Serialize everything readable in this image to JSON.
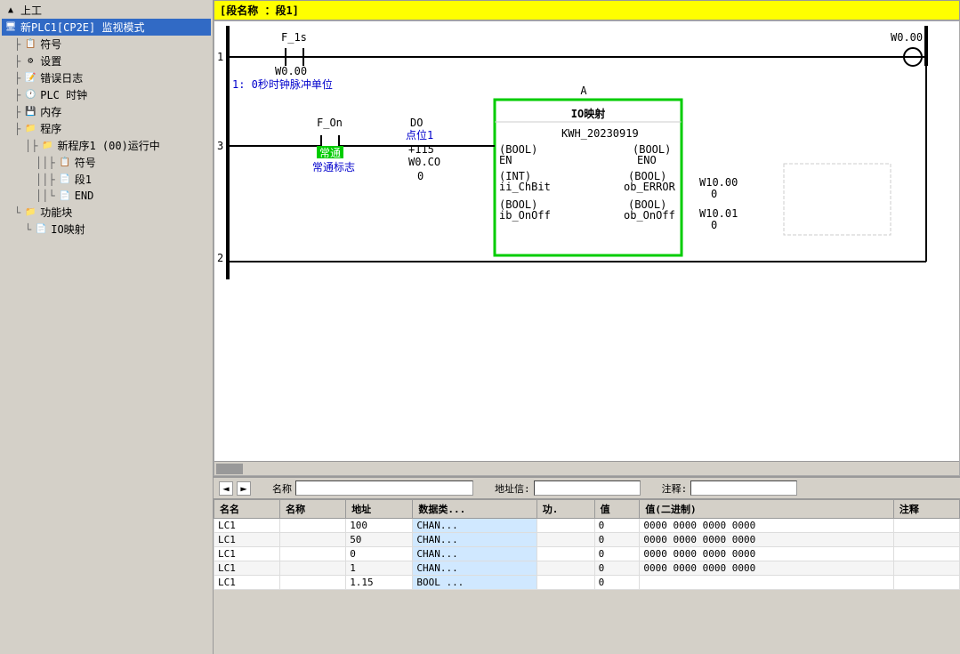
{
  "app": {
    "title": "新PLC1[CP2E] 监视模式"
  },
  "sidebar": {
    "items": [
      {
        "id": "plc-root",
        "label": "上工",
        "indent": 0,
        "icon": "📁"
      },
      {
        "id": "plc1",
        "label": "新PLC1[CP2E] 监视模式",
        "indent": 0,
        "icon": "🖥️"
      },
      {
        "id": "symbol",
        "label": "符号",
        "indent": 1,
        "icon": "📋"
      },
      {
        "id": "settings",
        "label": "设置",
        "indent": 1,
        "icon": "⚙️"
      },
      {
        "id": "error-log",
        "label": "错误日志",
        "indent": 1,
        "icon": "📝"
      },
      {
        "id": "plc-timer",
        "label": "PLC 时钟",
        "indent": 1,
        "icon": "🕐"
      },
      {
        "id": "memory",
        "label": "内存",
        "indent": 1,
        "icon": "💾"
      },
      {
        "id": "program",
        "label": "程序",
        "indent": 1,
        "icon": "📁"
      },
      {
        "id": "new-prog",
        "label": "新程序1 (00)运行中",
        "indent": 2,
        "icon": "📁"
      },
      {
        "id": "symbol2",
        "label": "符号",
        "indent": 3,
        "icon": "📋"
      },
      {
        "id": "rung1",
        "label": "段1",
        "indent": 3,
        "icon": "📄"
      },
      {
        "id": "end",
        "label": "END",
        "indent": 3,
        "icon": "📄"
      },
      {
        "id": "funcblock",
        "label": "功能块",
        "indent": 1,
        "icon": "📁"
      },
      {
        "id": "io-map",
        "label": "IO映射",
        "indent": 2,
        "icon": "📄"
      }
    ]
  },
  "diagram": {
    "title": "[段名称 ：段1]",
    "rung1": {
      "number": "1",
      "comment": "1: 0秒时钟脉冲单位",
      "contacts": [
        {
          "name": "F_1s",
          "address": "W0.00",
          "type": "normal"
        },
        {
          "name": "F_On",
          "address": "",
          "type": "normal"
        },
        {
          "name": "常通标志",
          "address": "",
          "type": "highlighted"
        }
      ],
      "coil": {
        "name": "W0.00",
        "type": "coil"
      },
      "funcblock": {
        "title": "IO映射",
        "label": "A",
        "ports_left": [
          {
            "type": "(BOOL)",
            "name": "EN"
          },
          {
            "type": "(INT)",
            "name": "ii_ChBit"
          },
          {
            "type": "(BOOL)",
            "name": "ib_OnOff"
          }
        ],
        "ports_right": [
          {
            "type": "(BOOL)",
            "name": "ENO"
          },
          {
            "type": "(BOOL)",
            "name": "ob_ERROR"
          },
          {
            "type": "(BOOL)",
            "name": "ob_OnOff"
          }
        ],
        "instance": "KWH_20230919",
        "output_values": [
          {
            "address": "W10.00",
            "value": "0"
          },
          {
            "address": "W10.01",
            "value": "0"
          }
        ]
      }
    },
    "rung2": {
      "number": "2"
    },
    "do_label": "DO",
    "do_bit": "点位1",
    "do_value": "+115",
    "do_addr": "W0.CO",
    "do_addr_val": "0"
  },
  "search_bar": {
    "name_label": "名称",
    "address_label": "地址信:",
    "note_label": "注释:"
  },
  "monitor_table": {
    "columns": [
      "名名",
      "名称",
      "地址",
      "数据类...",
      "功.",
      "值",
      "值(二进制)",
      "注释"
    ],
    "rows": [
      {
        "source": "LC1",
        "name": "",
        "address": "100",
        "datatype": "CHAN...",
        "flag": "",
        "value": "0",
        "binary": "0000 0000 0000 0000",
        "note": ""
      },
      {
        "source": "LC1",
        "name": "",
        "address": "50",
        "datatype": "CHAN...",
        "flag": "",
        "value": "0",
        "binary": "0000 0000 0000 0000",
        "note": ""
      },
      {
        "source": "LC1",
        "name": "",
        "address": "0",
        "datatype": "CHAN...",
        "flag": "",
        "value": "0",
        "binary": "0000 0000 0000 0000",
        "note": ""
      },
      {
        "source": "LC1",
        "name": "",
        "address": "1",
        "datatype": "CHAN...",
        "flag": "",
        "value": "0",
        "binary": "0000 0000 0000 0000",
        "note": ""
      },
      {
        "source": "LC1",
        "name": "",
        "address": "1.15",
        "datatype": "BOOL ...",
        "flag": "",
        "value": "0",
        "binary": "",
        "note": ""
      }
    ]
  }
}
